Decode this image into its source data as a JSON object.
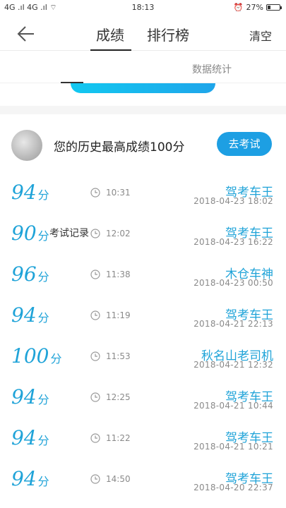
{
  "status_bar": {
    "signal_left": "4G .ıl 4G .ıl ⌔",
    "time": "18:13",
    "battery_label": "27%",
    "battery_level": 0.27
  },
  "nav": {
    "tab_score": "成绩",
    "tab_rank": "排行榜",
    "clear": "清空"
  },
  "sub_tabs": {
    "records": "考试记录",
    "stats": "数据统计"
  },
  "best": {
    "text": "您的历史最高成绩100分",
    "button": "去考试"
  },
  "records": [
    {
      "score": "94",
      "unit": "分",
      "time": "10:31",
      "title": "驾考车王",
      "datetime": "2018-04-23  18:02"
    },
    {
      "score": "90",
      "unit": "分",
      "time": "12:02",
      "title": "驾考车王",
      "datetime": "2018-04-23  16:22"
    },
    {
      "score": "96",
      "unit": "分",
      "time": "11:38",
      "title": "木仓车神",
      "datetime": "2018-04-23  00:50"
    },
    {
      "score": "94",
      "unit": "分",
      "time": "11:19",
      "title": "驾考车王",
      "datetime": "2018-04-21  22:13"
    },
    {
      "score": "100",
      "unit": "分",
      "time": "11:53",
      "title": "秋名山老司机",
      "datetime": "2018-04-21  12:32"
    },
    {
      "score": "94",
      "unit": "分",
      "time": "12:25",
      "title": "驾考车王",
      "datetime": "2018-04-21  10:44"
    },
    {
      "score": "94",
      "unit": "分",
      "time": "11:22",
      "title": "驾考车王",
      "datetime": "2018-04-21  10:21"
    },
    {
      "score": "94",
      "unit": "分",
      "time": "14:50",
      "title": "驾考车王",
      "datetime": "2018-04-20  22:37"
    }
  ],
  "colors": {
    "accent": "#1fa3d8",
    "button": "#1d9fe3"
  }
}
